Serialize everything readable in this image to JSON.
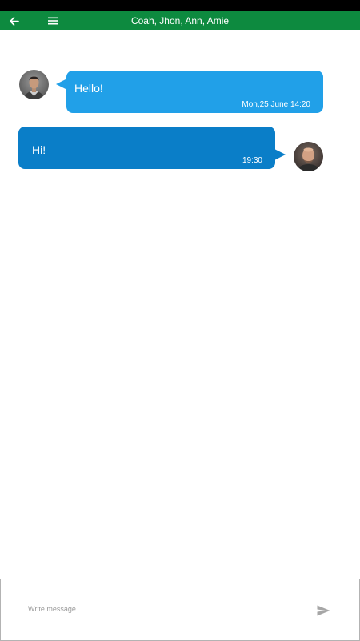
{
  "header": {
    "title": "Coah, Jhon, Ann, Amie",
    "back_icon": "arrow-left-icon",
    "menu_icon": "hamburger-menu-icon",
    "background": "#0d8a3f"
  },
  "messages": [
    {
      "text": "Hello!",
      "time": "Mon,25 June 14:20",
      "direction": "incoming",
      "color": "#21a0e8"
    },
    {
      "text": "Hi!",
      "time": "19:30",
      "direction": "outgoing",
      "color": "#0a7ec8"
    }
  ],
  "composer": {
    "placeholder": "Write message",
    "value": "",
    "send_icon": "send-icon"
  }
}
